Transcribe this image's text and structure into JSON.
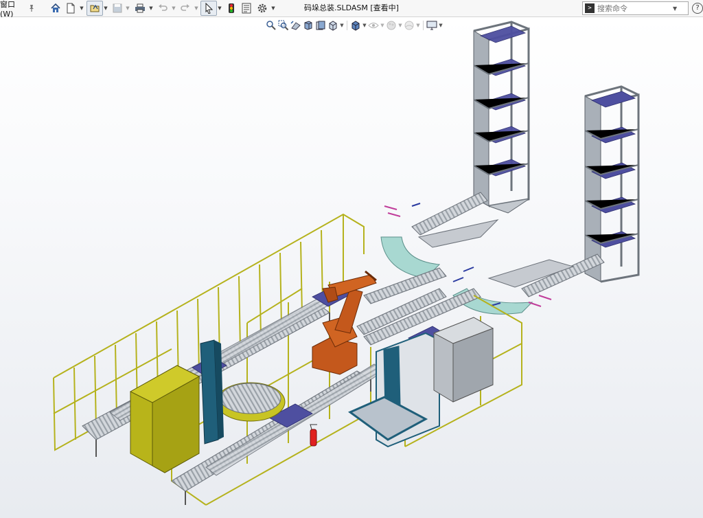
{
  "menu": {
    "window_label": "窗口(W)"
  },
  "document": {
    "title": "码垛总装.SLDASM [查看中]"
  },
  "search": {
    "placeholder": "搜索命令"
  },
  "icons": {
    "toolbar": [
      "home-icon",
      "new-document-icon",
      "open-icon",
      "save-icon",
      "print-icon",
      "undo-icon",
      "redo-icon",
      "select-arrow-icon",
      "traffic-light-icon",
      "file-properties-icon",
      "options-gear-icon"
    ],
    "view": [
      "zoom-to-fit-icon",
      "zoom-area-icon",
      "previous-view-icon",
      "section-view-icon",
      "dynamic-annotation-icon",
      "view-orientation-icon",
      "display-style-icon",
      "hide-show-icon",
      "edit-appearance-icon",
      "apply-scene-icon",
      "view-settings-icon"
    ]
  },
  "colors": {
    "fence": "#b5b21c",
    "conveyor_frame": "#8e96a0",
    "roller": "#cfd3d8",
    "pallet": "#4b4d9a",
    "robot": "#c4581c",
    "curve_conveyor": "#a9d7d1",
    "stacker_blue": "#1f5f7a",
    "guard_yellow": "#b8b41a",
    "extinguisher": "#e02020"
  }
}
